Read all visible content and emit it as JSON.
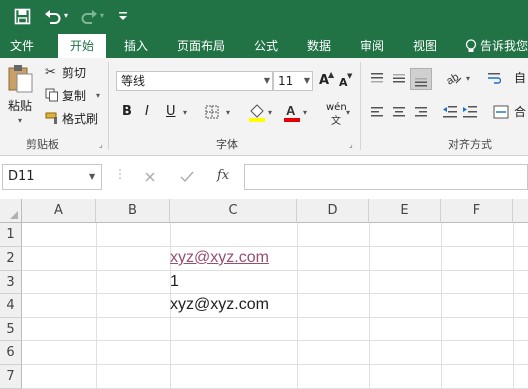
{
  "qat": {
    "save_icon": "save-icon",
    "undo_icon": "undo-icon",
    "redo_icon": "redo-icon",
    "customize_icon": "customize-icon"
  },
  "tabs": [
    "文件",
    "开始",
    "插入",
    "页面布局",
    "公式",
    "数据",
    "审阅",
    "视图"
  ],
  "tell_me": "告诉我您",
  "ribbon": {
    "clipboard": {
      "paste": "粘贴",
      "cut": "剪切",
      "copy": "复制",
      "format_painter": "格式刷",
      "group": "剪贴板"
    },
    "font": {
      "name": "等线",
      "size": "11",
      "grow": "A",
      "shrink": "A",
      "bold": "B",
      "italic": "I",
      "underline": "U",
      "phonetic": "wén",
      "group": "字体"
    },
    "alignment": {
      "wrap": "自",
      "merge": "合",
      "group": "对齐方式"
    }
  },
  "formula_bar": {
    "name_box": "D11",
    "fx": "fx",
    "value": ""
  },
  "columns": [
    "A",
    "B",
    "C",
    "D",
    "E",
    "F"
  ],
  "rows": [
    "1",
    "2",
    "3",
    "4",
    "5",
    "6",
    "7"
  ],
  "cells": {
    "C2": "xyz@xyz.com",
    "C3": "1",
    "C4": "xyz@xyz.com"
  },
  "colors": {
    "excel_green": "#217346",
    "link_purple": "#954f72",
    "fill_yellow": "#ffff00",
    "font_red": "#e00000"
  }
}
